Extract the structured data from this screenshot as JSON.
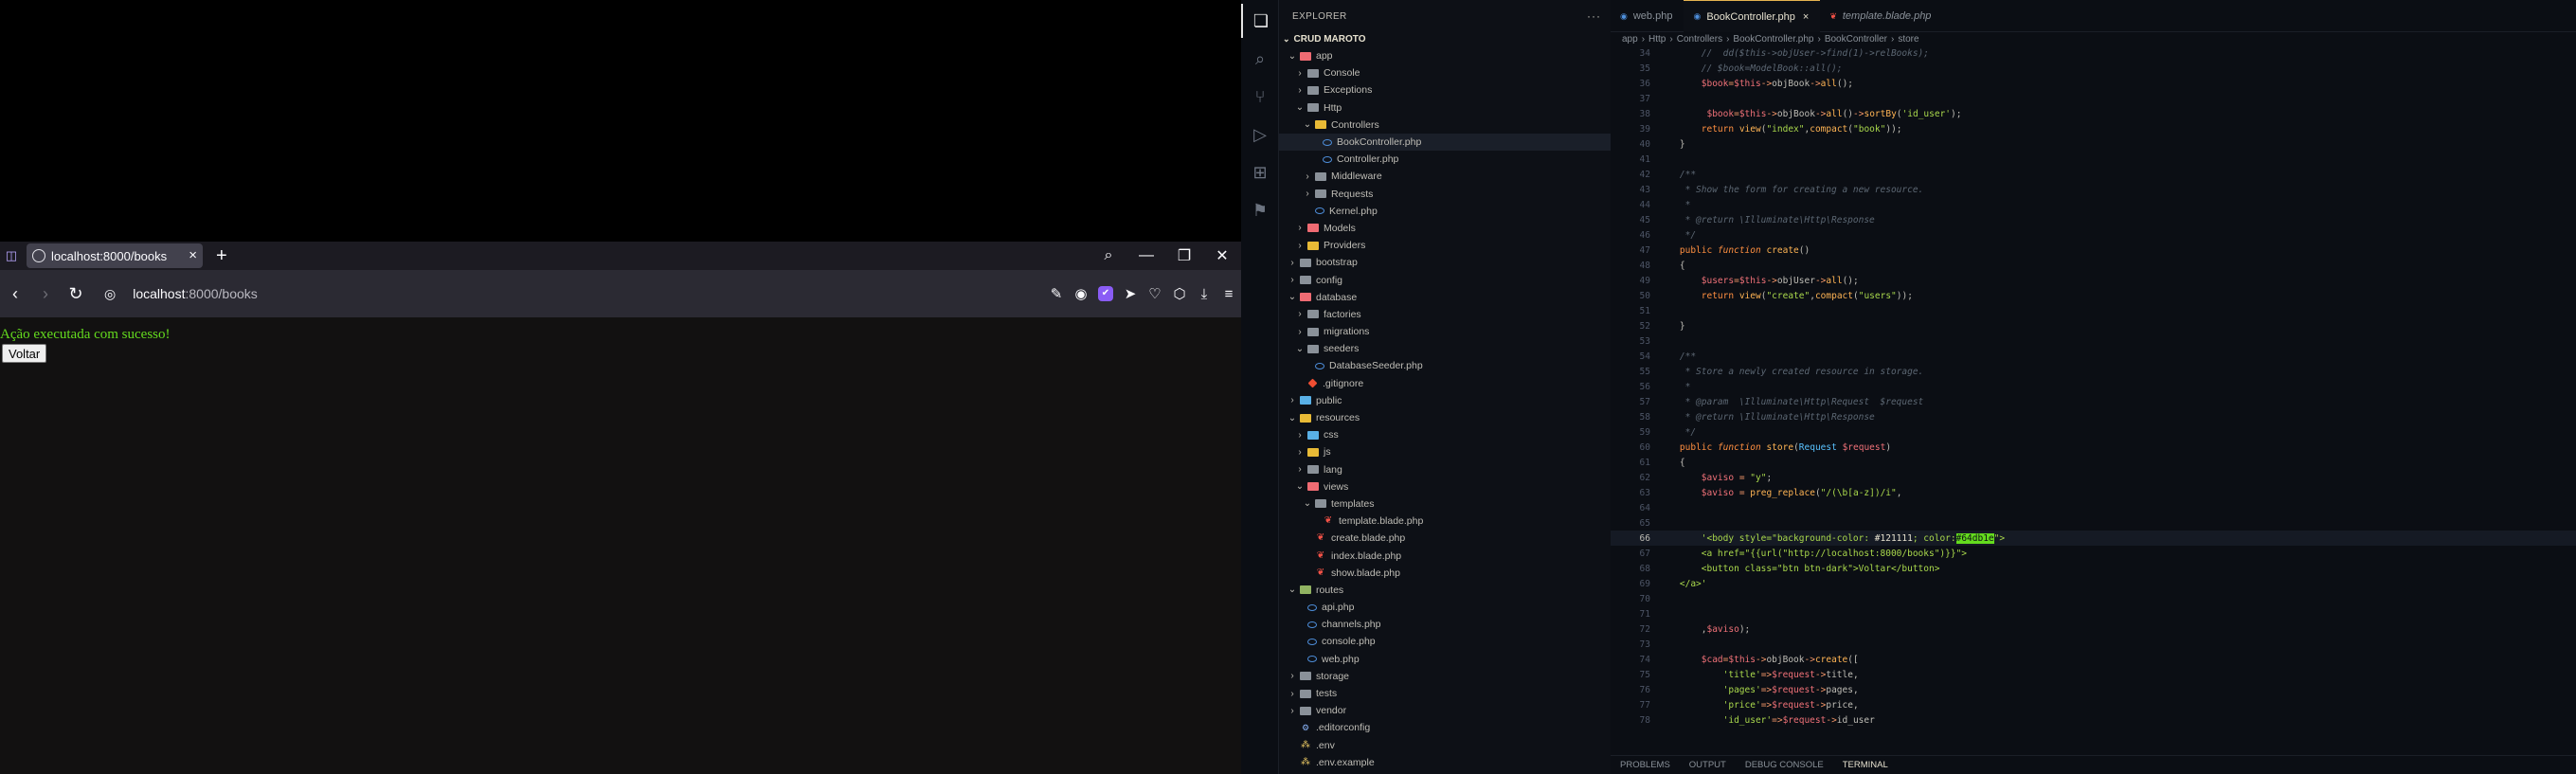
{
  "browser": {
    "tab_title": "localhost:8000/books",
    "close_icon": "×",
    "new_tab_icon": "+",
    "url_host": "localhost",
    "url_path": ":8000/books",
    "page": {
      "message": "Ação executada com sucesso!",
      "button_label": "Voltar",
      "message_color": "#64db1e",
      "background": "#121111"
    }
  },
  "vscode": {
    "explorer_title": "EXPLORER",
    "more_icon": "···",
    "root_folder": "CRUD MAROTO",
    "tree": [
      {
        "label": "app",
        "depth": 0,
        "kind": "folder",
        "color": "red",
        "open": true
      },
      {
        "label": "Console",
        "depth": 1,
        "kind": "folder",
        "color": "grey",
        "open": false
      },
      {
        "label": "Exceptions",
        "depth": 1,
        "kind": "folder",
        "color": "grey",
        "open": false
      },
      {
        "label": "Http",
        "depth": 1,
        "kind": "folder",
        "color": "grey",
        "open": true
      },
      {
        "label": "Controllers",
        "depth": 2,
        "kind": "folder",
        "color": "yellow",
        "open": true
      },
      {
        "label": "BookController.php",
        "depth": 3,
        "kind": "php",
        "selected": true
      },
      {
        "label": "Controller.php",
        "depth": 3,
        "kind": "php"
      },
      {
        "label": "Middleware",
        "depth": 2,
        "kind": "folder",
        "color": "grey",
        "open": false
      },
      {
        "label": "Requests",
        "depth": 2,
        "kind": "folder",
        "color": "grey",
        "open": false
      },
      {
        "label": "Kernel.php",
        "depth": 2,
        "kind": "php"
      },
      {
        "label": "Models",
        "depth": 1,
        "kind": "folder",
        "color": "red",
        "open": false
      },
      {
        "label": "Providers",
        "depth": 1,
        "kind": "folder",
        "color": "yellow",
        "open": false
      },
      {
        "label": "bootstrap",
        "depth": 0,
        "kind": "folder",
        "color": "grey",
        "open": false
      },
      {
        "label": "config",
        "depth": 0,
        "kind": "folder",
        "color": "grey",
        "open": false
      },
      {
        "label": "database",
        "depth": 0,
        "kind": "folder",
        "color": "red",
        "open": true
      },
      {
        "label": "factories",
        "depth": 1,
        "kind": "folder",
        "color": "grey",
        "open": false
      },
      {
        "label": "migrations",
        "depth": 1,
        "kind": "folder",
        "color": "grey",
        "open": false
      },
      {
        "label": "seeders",
        "depth": 1,
        "kind": "folder",
        "color": "grey",
        "open": true
      },
      {
        "label": "DatabaseSeeder.php",
        "depth": 2,
        "kind": "php"
      },
      {
        "label": ".gitignore",
        "depth": 1,
        "kind": "git"
      },
      {
        "label": "public",
        "depth": 0,
        "kind": "folder",
        "color": "blue",
        "open": false
      },
      {
        "label": "resources",
        "depth": 0,
        "kind": "folder",
        "color": "yellow",
        "open": true
      },
      {
        "label": "css",
        "depth": 1,
        "kind": "folder",
        "color": "blue",
        "open": false
      },
      {
        "label": "js",
        "depth": 1,
        "kind": "folder",
        "color": "yellow",
        "open": false
      },
      {
        "label": "lang",
        "depth": 1,
        "kind": "folder",
        "color": "grey",
        "open": false
      },
      {
        "label": "views",
        "depth": 1,
        "kind": "folder",
        "color": "red",
        "open": true
      },
      {
        "label": "templates",
        "depth": 2,
        "kind": "folder",
        "color": "grey",
        "open": true
      },
      {
        "label": "template.blade.php",
        "depth": 3,
        "kind": "blade"
      },
      {
        "label": "create.blade.php",
        "depth": 2,
        "kind": "blade"
      },
      {
        "label": "index.blade.php",
        "depth": 2,
        "kind": "blade"
      },
      {
        "label": "show.blade.php",
        "depth": 2,
        "kind": "blade"
      },
      {
        "label": "routes",
        "depth": 0,
        "kind": "folder",
        "color": "green",
        "open": true
      },
      {
        "label": "api.php",
        "depth": 1,
        "kind": "php"
      },
      {
        "label": "channels.php",
        "depth": 1,
        "kind": "php"
      },
      {
        "label": "console.php",
        "depth": 1,
        "kind": "php"
      },
      {
        "label": "web.php",
        "depth": 1,
        "kind": "php"
      },
      {
        "label": "storage",
        "depth": 0,
        "kind": "folder",
        "color": "grey",
        "open": false
      },
      {
        "label": "tests",
        "depth": 0,
        "kind": "folder",
        "color": "grey",
        "open": false
      },
      {
        "label": "vendor",
        "depth": 0,
        "kind": "folder",
        "color": "grey",
        "open": false
      },
      {
        "label": ".editorconfig",
        "depth": 0,
        "kind": "conf"
      },
      {
        "label": ".env",
        "depth": 0,
        "kind": "env"
      },
      {
        "label": ".env.example",
        "depth": 0,
        "kind": "env"
      }
    ],
    "tabs": [
      {
        "label": "web.php",
        "icon": "php",
        "active": false,
        "italic": false
      },
      {
        "label": "BookController.php",
        "icon": "php",
        "active": true,
        "italic": false
      },
      {
        "label": "template.blade.php",
        "icon": "blade",
        "active": false,
        "italic": true
      }
    ],
    "breadcrumb": [
      "app",
      "Http",
      "Controllers",
      "BookController.php",
      "BookController",
      "store"
    ],
    "current_line": 66,
    "code": [
      {
        "n": 34,
        "h": "        <span class=\"c\">//  dd($this->objUser->find(1)->relBooks);</span>"
      },
      {
        "n": 35,
        "h": "        <span class=\"c\">// $book=ModelBook::all();</span>"
      },
      {
        "n": 36,
        "h": "        <span class=\"v\">$book</span><span class=\"o\">=</span><span class=\"v\">$this</span><span class=\"o\">-></span>objBook<span class=\"o\">-></span><span class=\"fn\">all</span>();"
      },
      {
        "n": 37,
        "h": ""
      },
      {
        "n": 38,
        "h": "         <span class=\"v\">$book</span><span class=\"o\">=</span><span class=\"v\">$this</span><span class=\"o\">-></span>objBook<span class=\"o\">-></span><span class=\"fn\">all</span>()<span class=\"o\">-></span><span class=\"fn\">sortBy</span>(<span class=\"s\">'id_user'</span>);"
      },
      {
        "n": 39,
        "h": "        <span class=\"k\">return</span> <span class=\"fn\">view</span>(<span class=\"s\">\"index\"</span>,<span class=\"fn\">compact</span>(<span class=\"s\">\"book\"</span>));"
      },
      {
        "n": 40,
        "h": "    }"
      },
      {
        "n": 41,
        "h": ""
      },
      {
        "n": 42,
        "h": "    <span class=\"c\">/**</span>"
      },
      {
        "n": 43,
        "h": "<span class=\"c\">     * Show the form for creating a new resource.</span>"
      },
      {
        "n": 44,
        "h": "<span class=\"c\">     *</span>"
      },
      {
        "n": 45,
        "h": "<span class=\"c\">     * @return \\Illuminate\\Http\\Response</span>"
      },
      {
        "n": 46,
        "h": "<span class=\"c\">     */</span>"
      },
      {
        "n": 47,
        "h": "    <span class=\"k\">public</span> <span class=\"k\"><i>function</i></span> <span class=\"fn\">create</span>()"
      },
      {
        "n": 48,
        "h": "    {"
      },
      {
        "n": 49,
        "h": "        <span class=\"v\">$users</span><span class=\"o\">=</span><span class=\"v\">$this</span><span class=\"o\">-></span>objUser<span class=\"o\">-></span><span class=\"fn\">all</span>();"
      },
      {
        "n": 50,
        "h": "        <span class=\"k\">return</span> <span class=\"fn\">view</span>(<span class=\"s\">\"create\"</span>,<span class=\"fn\">compact</span>(<span class=\"s\">\"users\"</span>));"
      },
      {
        "n": 51,
        "h": ""
      },
      {
        "n": 52,
        "h": "    }"
      },
      {
        "n": 53,
        "h": ""
      },
      {
        "n": 54,
        "h": "    <span class=\"c\">/**</span>"
      },
      {
        "n": 55,
        "h": "<span class=\"c\">     * Store a newly created resource in storage.</span>"
      },
      {
        "n": 56,
        "h": "<span class=\"c\">     *</span>"
      },
      {
        "n": 57,
        "h": "<span class=\"c\">     * @param  \\Illuminate\\Http\\Request  $request</span>"
      },
      {
        "n": 58,
        "h": "<span class=\"c\">     * @return \\Illuminate\\Http\\Response</span>"
      },
      {
        "n": 59,
        "h": "<span class=\"c\">     */</span>"
      },
      {
        "n": 60,
        "h": "    <span class=\"k\">public</span> <span class=\"k\"><i>function</i></span> <span class=\"fn\">store</span>(<span class=\"t\">Request</span> <span class=\"v\">$request</span>)"
      },
      {
        "n": 61,
        "h": "    {"
      },
      {
        "n": 62,
        "h": "        <span class=\"v\">$aviso</span> <span class=\"o\">=</span> <span class=\"s\">\"y\"</span>;"
      },
      {
        "n": 63,
        "h": "        <span class=\"v\">$aviso</span> <span class=\"o\">=</span> <span class=\"fn\">preg_replace</span>(<span class=\"s\">\"/(\\b[a-z])/i\"</span>,"
      },
      {
        "n": 64,
        "h": ""
      },
      {
        "n": 65,
        "h": ""
      },
      {
        "n": 66,
        "h": "        <span class=\"s\">'&lt;body style=\"background-color: </span><span style=\"color:#e6e1cf\">#121111</span><span class=\"s\">; color:</span><span class=\"hl\">#64db1e</span><span class=\"s\">\"></span>"
      },
      {
        "n": 67,
        "h": "        <span class=\"s\">&lt;a href=\"{{url(\"http://localhost:8000/books\")}}\"></span>"
      },
      {
        "n": 68,
        "h": "        <span class=\"s\">&lt;button class=\"btn btn-dark\">Voltar&lt;/button></span>"
      },
      {
        "n": 69,
        "h": "    <span class=\"s\">&lt;/a>'</span>"
      },
      {
        "n": 70,
        "h": ""
      },
      {
        "n": 71,
        "h": ""
      },
      {
        "n": 72,
        "h": "        ,<span class=\"v\">$aviso</span>);"
      },
      {
        "n": 73,
        "h": ""
      },
      {
        "n": 74,
        "h": "        <span class=\"v\">$cad</span><span class=\"o\">=</span><span class=\"v\">$this</span><span class=\"o\">-></span>objBook<span class=\"o\">-></span><span class=\"fn\">create</span>(["
      },
      {
        "n": 75,
        "h": "            <span class=\"s\">'title'</span><span class=\"o\">=></span><span class=\"v\">$request</span><span class=\"o\">-></span>title,"
      },
      {
        "n": 76,
        "h": "            <span class=\"s\">'pages'</span><span class=\"o\">=></span><span class=\"v\">$request</span><span class=\"o\">-></span>pages,"
      },
      {
        "n": 77,
        "h": "            <span class=\"s\">'price'</span><span class=\"o\">=></span><span class=\"v\">$request</span><span class=\"o\">-></span>price,"
      },
      {
        "n": 78,
        "h": "            <span class=\"s\">'id_user'</span><span class=\"o\">=></span><span class=\"v\">$request</span><span class=\"o\">-></span>id_user"
      }
    ],
    "panel_tabs": [
      {
        "label": "PROBLEMS",
        "active": false
      },
      {
        "label": "OUTPUT",
        "active": false
      },
      {
        "label": "DEBUG CONSOLE",
        "active": false
      },
      {
        "label": "TERMINAL",
        "active": true
      }
    ]
  }
}
